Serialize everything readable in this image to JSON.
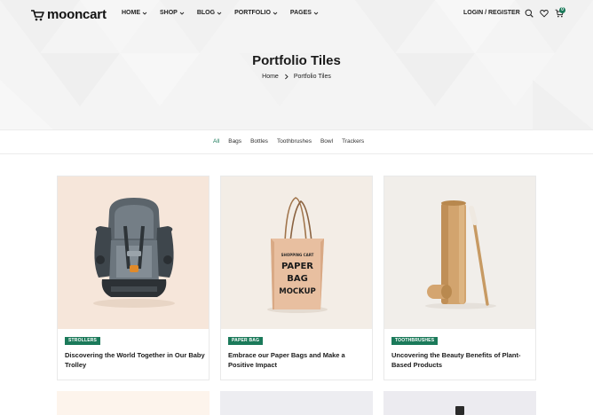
{
  "header": {
    "logo_text": "mooncart",
    "menu": [
      {
        "label": "HOME"
      },
      {
        "label": "SHOP"
      },
      {
        "label": "BLOG"
      },
      {
        "label": "PORTFOLIO"
      },
      {
        "label": "PAGES"
      }
    ],
    "login_label": "LOGIN / REGISTER",
    "cart_count": "0"
  },
  "page": {
    "title": "Portfolio Tiles",
    "breadcrumb": [
      "Home",
      "Portfolio Tiles"
    ]
  },
  "filters": [
    "All",
    "Bags",
    "Bottles",
    "Toothbrushes",
    "Bowl",
    "Trackers"
  ],
  "active_filter": "All",
  "cards": [
    {
      "tag": "STROLLERS",
      "title": "Discovering the World Together in Our Baby Trolley"
    },
    {
      "tag": "PAPER BAG",
      "title": "Embrace our Paper Bags and Make a Positive Impact"
    },
    {
      "tag": "TOOTHBRUSHES",
      "title": "Uncovering the Beauty Benefits of Plant-Based Products"
    }
  ],
  "product_images": {
    "bag_print": [
      "SHOPPING CART",
      "PAPER",
      "BAG",
      "MOCKUP"
    ]
  },
  "colors": {
    "accent": "#1b7a5a",
    "hero_bg": "#f4f4f4",
    "card1_bg": "#f6e6da",
    "card2_bg": "#f3ede6",
    "card3_bg": "#f1eeea"
  }
}
